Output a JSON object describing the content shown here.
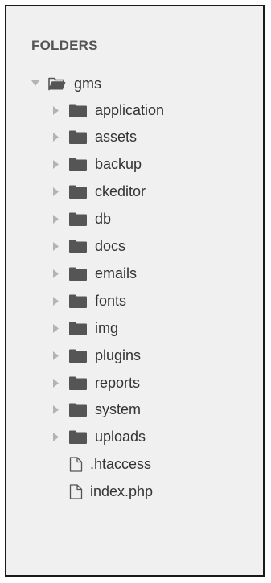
{
  "sidebar": {
    "header": "FOLDERS",
    "root": {
      "label": "gms",
      "expanded": true,
      "icon": "folder-open-icon"
    },
    "items": [
      {
        "label": "application",
        "type": "folder"
      },
      {
        "label": "assets",
        "type": "folder"
      },
      {
        "label": "backup",
        "type": "folder"
      },
      {
        "label": "ckeditor",
        "type": "folder"
      },
      {
        "label": "db",
        "type": "folder"
      },
      {
        "label": "docs",
        "type": "folder"
      },
      {
        "label": "emails",
        "type": "folder"
      },
      {
        "label": "fonts",
        "type": "folder"
      },
      {
        "label": "img",
        "type": "folder"
      },
      {
        "label": "plugins",
        "type": "folder"
      },
      {
        "label": "reports",
        "type": "folder"
      },
      {
        "label": "system",
        "type": "folder"
      },
      {
        "label": "uploads",
        "type": "folder"
      },
      {
        "label": ".htaccess",
        "type": "file"
      },
      {
        "label": "index.php",
        "type": "file"
      }
    ]
  },
  "colors": {
    "panel_background": "#f0f0f0",
    "header_text": "#555555",
    "item_text": "#333333",
    "folder_fill": "#555555",
    "caret": "#b3b3b3"
  }
}
